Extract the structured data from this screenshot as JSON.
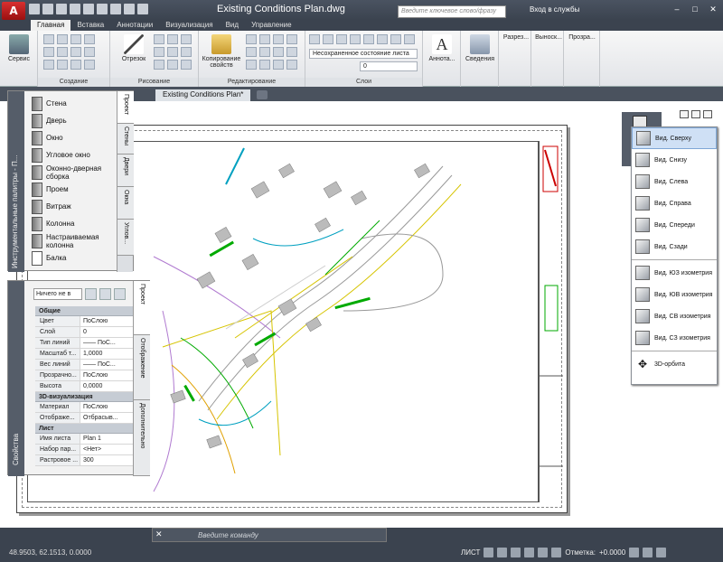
{
  "window": {
    "title": "Existing Conditions Plan.dwg",
    "app_letter": "A",
    "search_placeholder": "Введите ключевое слово/фразу",
    "login": "Вход в службы"
  },
  "ribbon_tabs": [
    "Главная",
    "Вставка",
    "Аннотации",
    "Визуализация",
    "Вид",
    "Управление"
  ],
  "ribbon": {
    "service": "Сервис",
    "group_create": "Создание",
    "segment": "Отрезок",
    "group_draw": "Рисование",
    "copy_props": "Копирование свойств",
    "group_edit": "Редактирование",
    "layer_state": "Несохраненное состояние листа",
    "layer_value": "0",
    "group_layers": "Слои",
    "annot": "Аннота...",
    "info": "Сведения",
    "razrez": "Разрез...",
    "vynos": "Выноск...",
    "prozra": "Прозра..."
  },
  "doc_tab": "Existing Conditions Plan*",
  "tool_palette": {
    "title": "Инструментальные палитры - П...",
    "items": [
      "Стена",
      "Дверь",
      "Окно",
      "Угловое окно",
      "Оконно-дверная сборка",
      "Проем",
      "Витраж",
      "Колонна",
      "Настраиваемая колонна",
      "Балка"
    ],
    "tabs": [
      "Проект",
      "Стены",
      "Двери",
      "Окна",
      "Углов..."
    ]
  },
  "properties": {
    "title": "Свойства",
    "select": "Ничего не в",
    "sections": [
      {
        "name": "Общие",
        "rows": [
          [
            "Цвет",
            "ПоСлою"
          ],
          [
            "Слой",
            "0"
          ],
          [
            "Тип линий",
            "—— ПоС..."
          ],
          [
            "Масштаб т...",
            "1,0000"
          ],
          [
            "Вес линий",
            "—— ПоС..."
          ],
          [
            "Прозрачно...",
            "ПоСлою"
          ],
          [
            "Высота",
            "0,0000"
          ]
        ]
      },
      {
        "name": "3D-визуализация",
        "rows": [
          [
            "Материал",
            "ПоСлою"
          ],
          [
            "Отображе...",
            "Отбрасыв..."
          ]
        ]
      },
      {
        "name": "Лист",
        "rows": [
          [
            "Имя листа",
            "Plan 1"
          ],
          [
            "Набор пар...",
            "<Нет>"
          ],
          [
            "Растровое ...",
            "300"
          ]
        ]
      }
    ],
    "tabs": [
      "Проект",
      "Отображение",
      "Дополнительно"
    ]
  },
  "view_menu": {
    "items": [
      "Вид. Сверху",
      "Вид. Снизу",
      "Вид. Слева",
      "Вид. Справа",
      "Вид. Спереди",
      "Вид. Сзади"
    ],
    "iso_items": [
      "Вид. ЮЗ изометрия",
      "Вид. ЮВ изометрия",
      "Вид. СВ изометрия",
      "Вид. СЗ изометрия"
    ],
    "orbit": "3D-орбита"
  },
  "command_placeholder": "Введите команду",
  "status": {
    "coords": "48.9503, 62.1513, 0.0000",
    "mode": "ЛИСТ",
    "offset_label": "Отметка:",
    "offset_value": "+0.0000"
  }
}
